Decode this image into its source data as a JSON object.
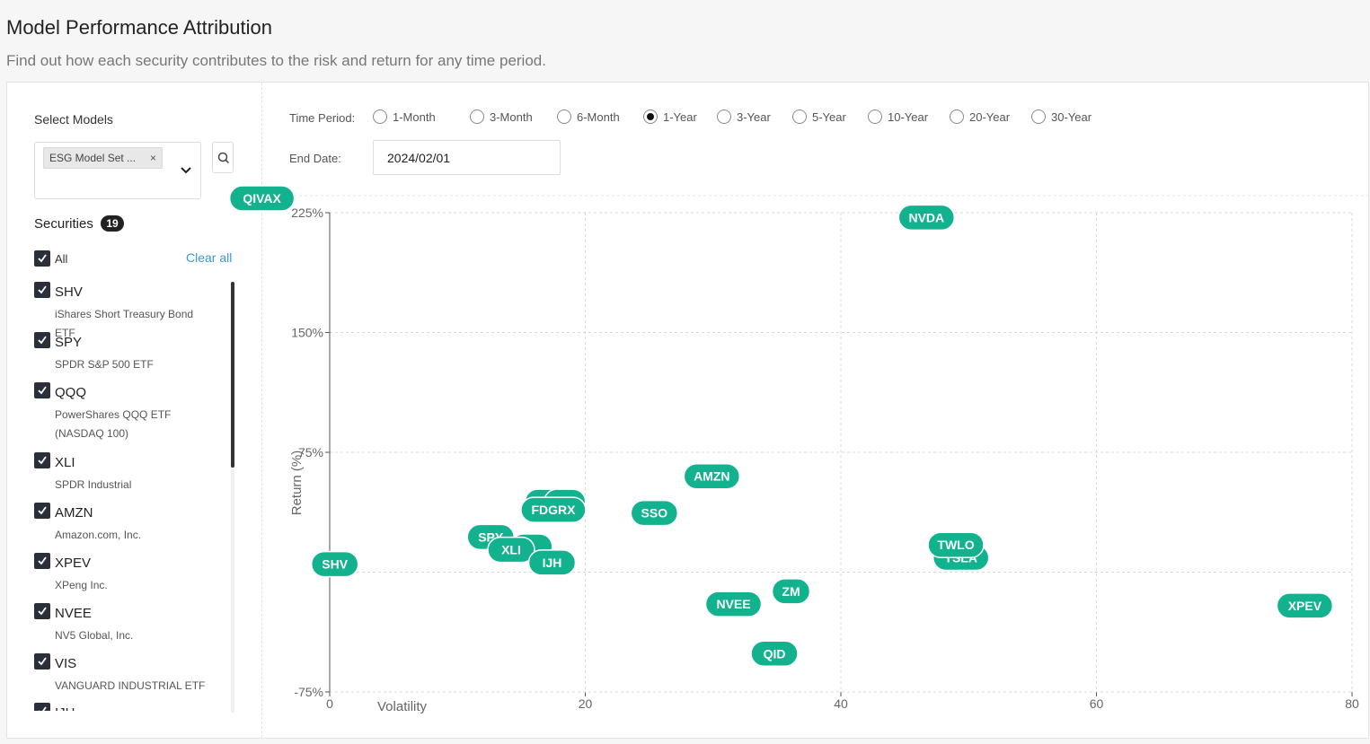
{
  "header": {
    "title": "Model Performance Attribution",
    "subtitle": "Find out how each security contributes to the risk and return for any time period."
  },
  "sidebar": {
    "select_models_label": "Select Models",
    "selected_model_chip": "ESG Model Set ...",
    "chip_remove": "×",
    "securities_label": "Securities",
    "securities_count": "19",
    "all_label": "All",
    "clear_all_label": "Clear all",
    "securities": [
      {
        "ticker": "SHV",
        "name": "iShares Short Treasury Bond ETF",
        "checked": true
      },
      {
        "ticker": "SPY",
        "name": "SPDR S&P 500 ETF",
        "checked": true
      },
      {
        "ticker": "QQQ",
        "name": "PowerShares QQQ ETF (NASDAQ 100)",
        "checked": true
      },
      {
        "ticker": "XLI",
        "name": "SPDR Industrial",
        "checked": true
      },
      {
        "ticker": "AMZN",
        "name": "Amazon.com, Inc.",
        "checked": true
      },
      {
        "ticker": "XPEV",
        "name": "XPeng Inc.",
        "checked": true
      },
      {
        "ticker": "NVEE",
        "name": "NV5 Global, Inc.",
        "checked": true
      },
      {
        "ticker": "VIS",
        "name": "VANGUARD INDUSTRIAL ETF",
        "checked": true
      },
      {
        "ticker": "IJH",
        "name": "",
        "checked": true
      }
    ]
  },
  "filters": {
    "time_period_label": "Time Period:",
    "time_periods": [
      "1-Month",
      "3-Month",
      "6-Month",
      "1-Year",
      "3-Year",
      "5-Year",
      "10-Year",
      "20-Year",
      "30-Year"
    ],
    "selected_time_period": "1-Year",
    "end_date_label": "End Date:",
    "end_date_value": "2024/02/01"
  },
  "colors": {
    "bubble": "#13b28e",
    "accent_link": "#3a9ad9"
  },
  "icons": {
    "search": "search-icon",
    "dropdown": "chevron-down-icon",
    "check": "check-icon"
  },
  "chart_data": {
    "type": "scatter",
    "xlabel": "Volatility",
    "ylabel": "Return (%)",
    "xlim": [
      0,
      80
    ],
    "ylim": [
      -75,
      225
    ],
    "x_ticks": [
      "0",
      "20",
      "40",
      "60",
      "80"
    ],
    "y_ticks": [
      "-75%",
      "0",
      "75%",
      "150%",
      "225%"
    ],
    "grid": true,
    "points": [
      {
        "label": "QIVAX",
        "x": -5.3,
        "y": 234
      },
      {
        "label": "NVDA",
        "x": 46.7,
        "y": 222
      },
      {
        "label": "AMZN",
        "x": 29.9,
        "y": 60
      },
      {
        "label": "",
        "x": 16.9,
        "y": 44
      },
      {
        "label": "",
        "x": 18.4,
        "y": 44
      },
      {
        "label": "FDGRX",
        "x": 17.5,
        "y": 39
      },
      {
        "label": "SSO",
        "x": 25.4,
        "y": 37
      },
      {
        "label": "SPY",
        "x": 12.6,
        "y": 22
      },
      {
        "label": "",
        "x": 15.8,
        "y": 16
      },
      {
        "label": "XLI",
        "x": 14.2,
        "y": 14
      },
      {
        "label": "IJH",
        "x": 17.4,
        "y": 6
      },
      {
        "label": "SHV",
        "x": 0.4,
        "y": 5
      },
      {
        "label": "TSLA",
        "x": 49.4,
        "y": 9
      },
      {
        "label": "TWLO",
        "x": 49.0,
        "y": 17
      },
      {
        "label": "ZM",
        "x": 36.1,
        "y": -12
      },
      {
        "label": "NVEE",
        "x": 31.6,
        "y": -20
      },
      {
        "label": "XPEV",
        "x": 76.3,
        "y": -21
      },
      {
        "label": "QID",
        "x": 34.8,
        "y": -51
      }
    ]
  }
}
